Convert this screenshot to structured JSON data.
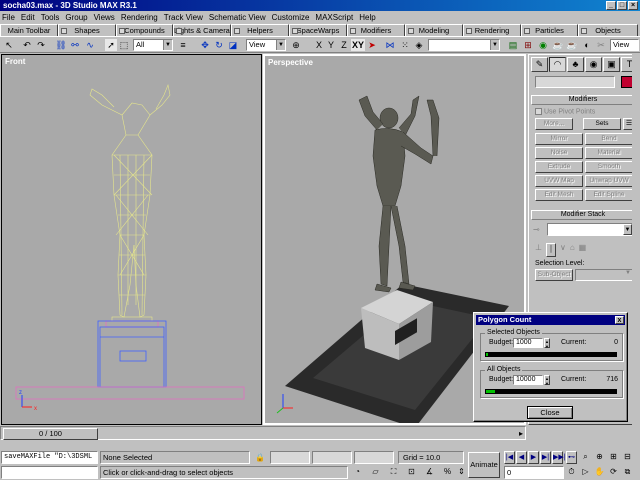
{
  "window": {
    "title": "socha03.max - 3D Studio MAX R3.1"
  },
  "menu": [
    "File",
    "Edit",
    "Tools",
    "Group",
    "Views",
    "Rendering",
    "Track View",
    "Schematic View",
    "Customize",
    "MAXScript",
    "Help"
  ],
  "tabs": [
    "Main Toolbar",
    "Shapes",
    "Compounds",
    "Lights & Cameras",
    "Helpers",
    "SpaceWarps",
    "Modifiers",
    "Modeling",
    "Rendering",
    "Particles",
    "Objects"
  ],
  "toolbar": {
    "selection_filter": "All",
    "ref_coord": "View",
    "axis_x": "X",
    "axis_y": "Y",
    "axis_z": "Z",
    "axis_xy": "XY",
    "named_selection": "",
    "view_right": "View"
  },
  "viewports": {
    "front_label": "Front",
    "persp_label": "Perspective"
  },
  "command_panel": {
    "modifiers_header": "Modifiers",
    "use_pivot_points": "Use Pivot Points",
    "more": "More...",
    "sets": "Sets",
    "buttons": [
      "Mirror",
      "Bend",
      "Noise",
      "Material",
      "Extrude",
      "Smooth",
      "UVW Map",
      "Unwrap UVW",
      "Edit Mesh",
      "Edit Spline"
    ],
    "modifier_stack_header": "Modifier Stack",
    "selection_level_label": "Selection Level:",
    "sub_object": "Sub-Object"
  },
  "timeline": {
    "frame_display": "0 / 100"
  },
  "status": {
    "maxscript_text": "saveMAXFile \"D:\\3DSML",
    "selection": "None Selected",
    "prompt": "Click or click-and-drag to select objects",
    "grid": "Grid = 10.0",
    "animate": "Animate",
    "current_frame": "0"
  },
  "polygon_dialog": {
    "title": "Polygon Count",
    "close_x": "x",
    "selected_group": "Selected Objects",
    "all_group": "All Objects",
    "budget_label": "Budget:",
    "current_label": "Current:",
    "selected_budget": "1000",
    "selected_current": "0",
    "all_budget": "10000",
    "all_current": "716",
    "selected_fraction": 0.0,
    "all_fraction": 0.072,
    "close_button": "Close"
  },
  "colors": {
    "title_bar": "#000080",
    "viewport_bg": "#a9a9a9",
    "wireframe": "#e6e68c",
    "pedestal_wire": "#4060ff",
    "grid_pink": "#e070c0",
    "progress_green": "#00c000",
    "active_swatch": "#c00030"
  }
}
